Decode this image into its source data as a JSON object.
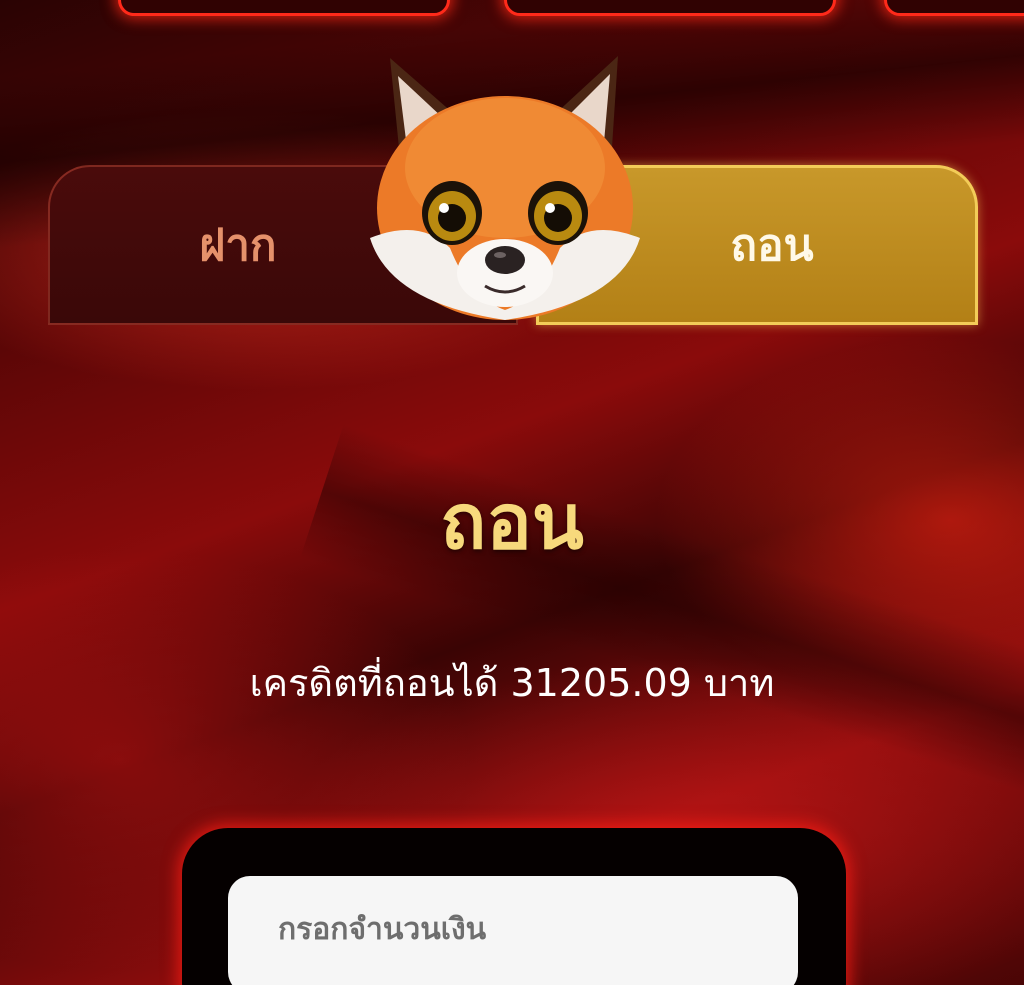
{
  "tabs": {
    "deposit_label": "ฝาก",
    "withdraw_label": "ถอน",
    "active": "withdraw"
  },
  "mascot": {
    "icon": "fox-mascot-icon"
  },
  "main": {
    "title": "ถอน",
    "credit_text": "เครดิตที่ถอนได้ 31205.09 บาท"
  },
  "amount_input": {
    "placeholder": "กรอกจำนวนเงิน",
    "value": ""
  },
  "colors": {
    "accent_gold": "#c8982a",
    "title_gold": "#f7d97c",
    "neon_red": "#ff2a1a",
    "background_red": "#8a0b0b"
  }
}
